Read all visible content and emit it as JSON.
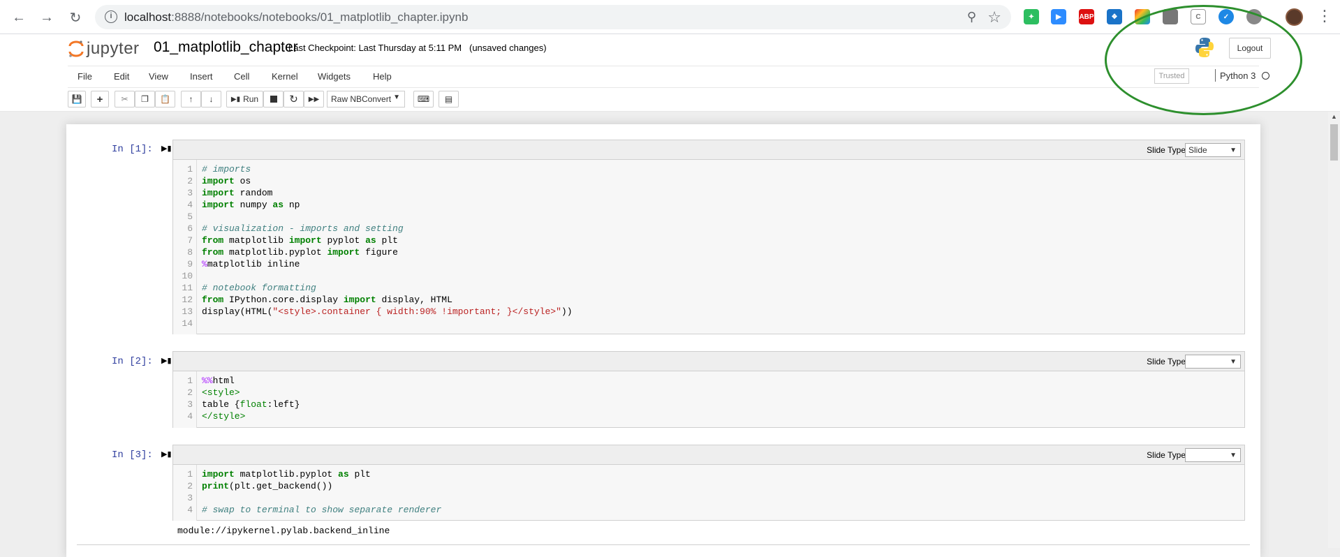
{
  "browser": {
    "url_host": "localhost",
    "url_rest": ":8888/notebooks/notebooks/01_matplotlib_chapter.ipynb",
    "extensions": [
      "evernote-icon",
      "zoom-icon",
      "adblock-icon",
      "safari-compass-icon",
      "colorwheel-icon",
      "folder-icon",
      "clipboard-icon",
      "checkmark-icon",
      "circle-icon"
    ],
    "adblock_label": "ABP"
  },
  "header": {
    "logo_text": "jupyter",
    "notebook_name": "01_matplotlib_chapter",
    "checkpoint_text": "Last Checkpoint: Last Thursday at 5:11 PM",
    "autosave_status": "(unsaved changes)",
    "logout_label": "Logout"
  },
  "menubar": {
    "items": [
      "File",
      "Edit",
      "View",
      "Insert",
      "Cell",
      "Kernel",
      "Widgets",
      "Help"
    ],
    "trusted_label": "Trusted",
    "kernel_name": "Python 3"
  },
  "toolbar": {
    "run_label": "Run",
    "cell_type": "Raw NBConvert"
  },
  "cells": [
    {
      "prompt": "In [1]:",
      "slide_type_label": "Slide Type",
      "slide_type_value": "Slide",
      "line_numbers": [
        "1",
        "2",
        "3",
        "4",
        "5",
        "6",
        "7",
        "8",
        "9",
        "10",
        "11",
        "12",
        "13",
        "14"
      ]
    },
    {
      "prompt": "In [2]:",
      "slide_type_label": "Slide Type",
      "slide_type_value": "",
      "line_numbers": [
        "1",
        "2",
        "3",
        "4"
      ]
    },
    {
      "prompt": "In [3]:",
      "slide_type_label": "Slide Type",
      "slide_type_value": "",
      "line_numbers": [
        "1",
        "2",
        "3",
        "4"
      ],
      "output": "module://ipykernel.pylab.backend_inline"
    }
  ],
  "code": {
    "c1": {
      "l1": "# imports",
      "l2_kw": "import",
      "l2_rest": " os",
      "l3_kw": "import",
      "l3_rest": " random",
      "l4_kw": "import",
      "l4_mid": " numpy ",
      "l4_kw2": "as",
      "l4_rest": " np",
      "l6": "# visualization - imports and setting",
      "l7_kw": "from",
      "l7_mid": " matplotlib ",
      "l7_kw2": "import",
      "l7_mid2": " pyplot ",
      "l7_kw3": "as",
      "l7_rest": " plt",
      "l8_kw": "from",
      "l8_mid": " matplotlib.pyplot ",
      "l8_kw2": "import",
      "l8_rest": " figure",
      "l9_mg": "%",
      "l9_rest": "matplotlib inline",
      "l11": "# notebook formatting",
      "l12_kw": "from",
      "l12_mid": " IPython.core.display ",
      "l12_kw2": "import",
      "l12_rest": " display, HTML",
      "l13_pre": "display(HTML(",
      "l13_str": "\"<style>.container { width:90% !important; }</style>\"",
      "l13_post": "))"
    },
    "c2": {
      "l1_mg": "%%",
      "l1_rest": "html",
      "l2": "<style>",
      "l3_pre": "table {",
      "l3_prop": "float",
      "l3_post": ":left}",
      "l4": "</style>"
    },
    "c3": {
      "l1_kw": "import",
      "l1_mid": " matplotlib.pyplot ",
      "l1_kw2": "as",
      "l1_rest": " plt",
      "l2_kw": "print",
      "l2_rest": "(plt.get_backend())",
      "l4": "# swap to terminal to show separate renderer"
    }
  },
  "colors": {
    "annotation": "#2d8f2d",
    "prompt": "#303f9f",
    "keyword": "#008000",
    "comment": "#408080",
    "string": "#ba2121",
    "magic": "#aa22ff"
  }
}
